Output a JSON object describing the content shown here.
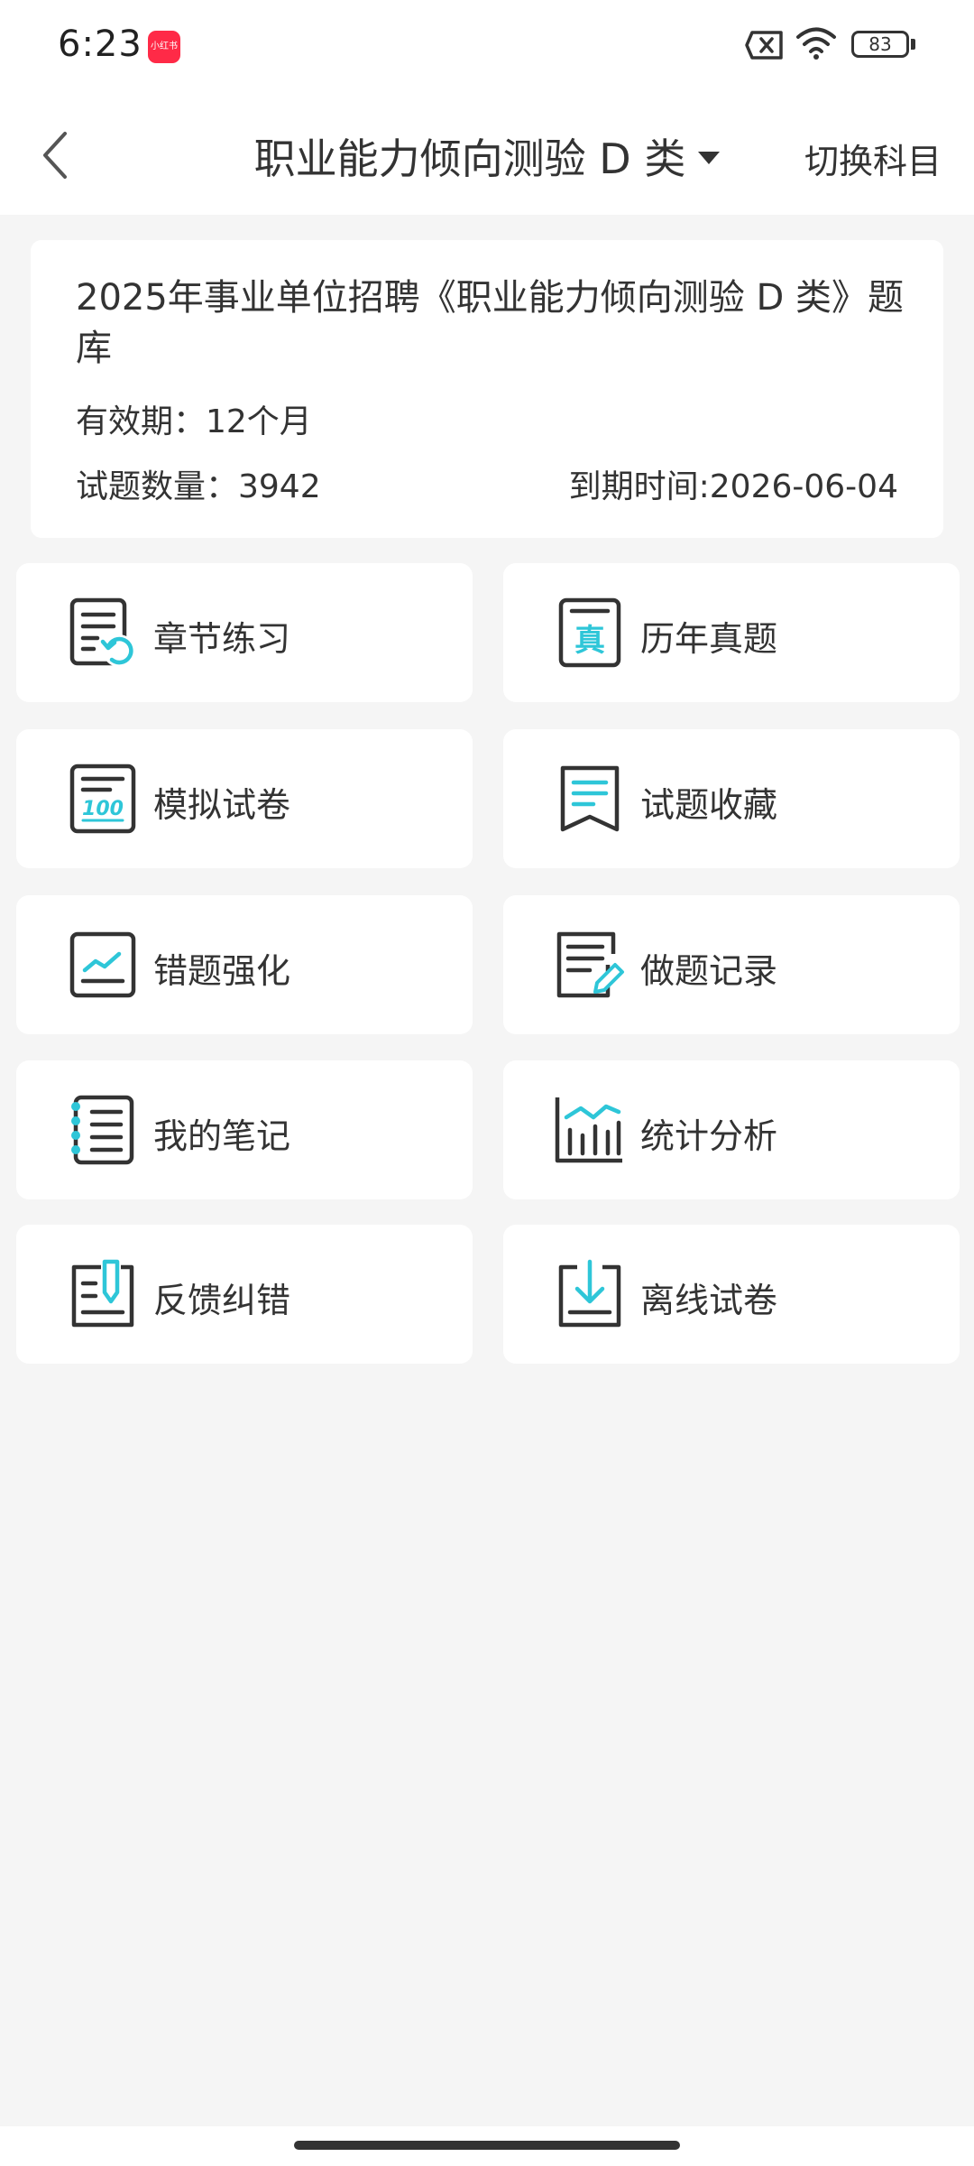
{
  "status_bar": {
    "time": "6:23",
    "notification_app_label": "小红书",
    "battery_level": "83"
  },
  "header": {
    "title": "职业能力倾向测验 D 类",
    "switch_label": "切换科目"
  },
  "info": {
    "title": "2025年事业单位招聘《职业能力倾向测验 D 类》题库",
    "validity": "有效期：12个月",
    "question_count": "试题数量：3942",
    "expiry": "到期时间:2026-06-04"
  },
  "tiles": [
    {
      "label": "章节练习",
      "icon": "chapter-practice-icon"
    },
    {
      "label": "历年真题",
      "icon": "past-exams-icon"
    },
    {
      "label": "模拟试卷",
      "icon": "mock-paper-icon"
    },
    {
      "label": "试题收藏",
      "icon": "bookmark-icon"
    },
    {
      "label": "错题强化",
      "icon": "wrong-questions-icon"
    },
    {
      "label": "做题记录",
      "icon": "record-icon"
    },
    {
      "label": "我的笔记",
      "icon": "notes-icon"
    },
    {
      "label": "统计分析",
      "icon": "statistics-icon"
    },
    {
      "label": "反馈纠错",
      "icon": "feedback-icon"
    },
    {
      "label": "离线试卷",
      "icon": "download-icon"
    }
  ],
  "colors": {
    "accent": "#2ec6d8",
    "icon_stroke": "#333333",
    "background": "#f5f5f5"
  }
}
